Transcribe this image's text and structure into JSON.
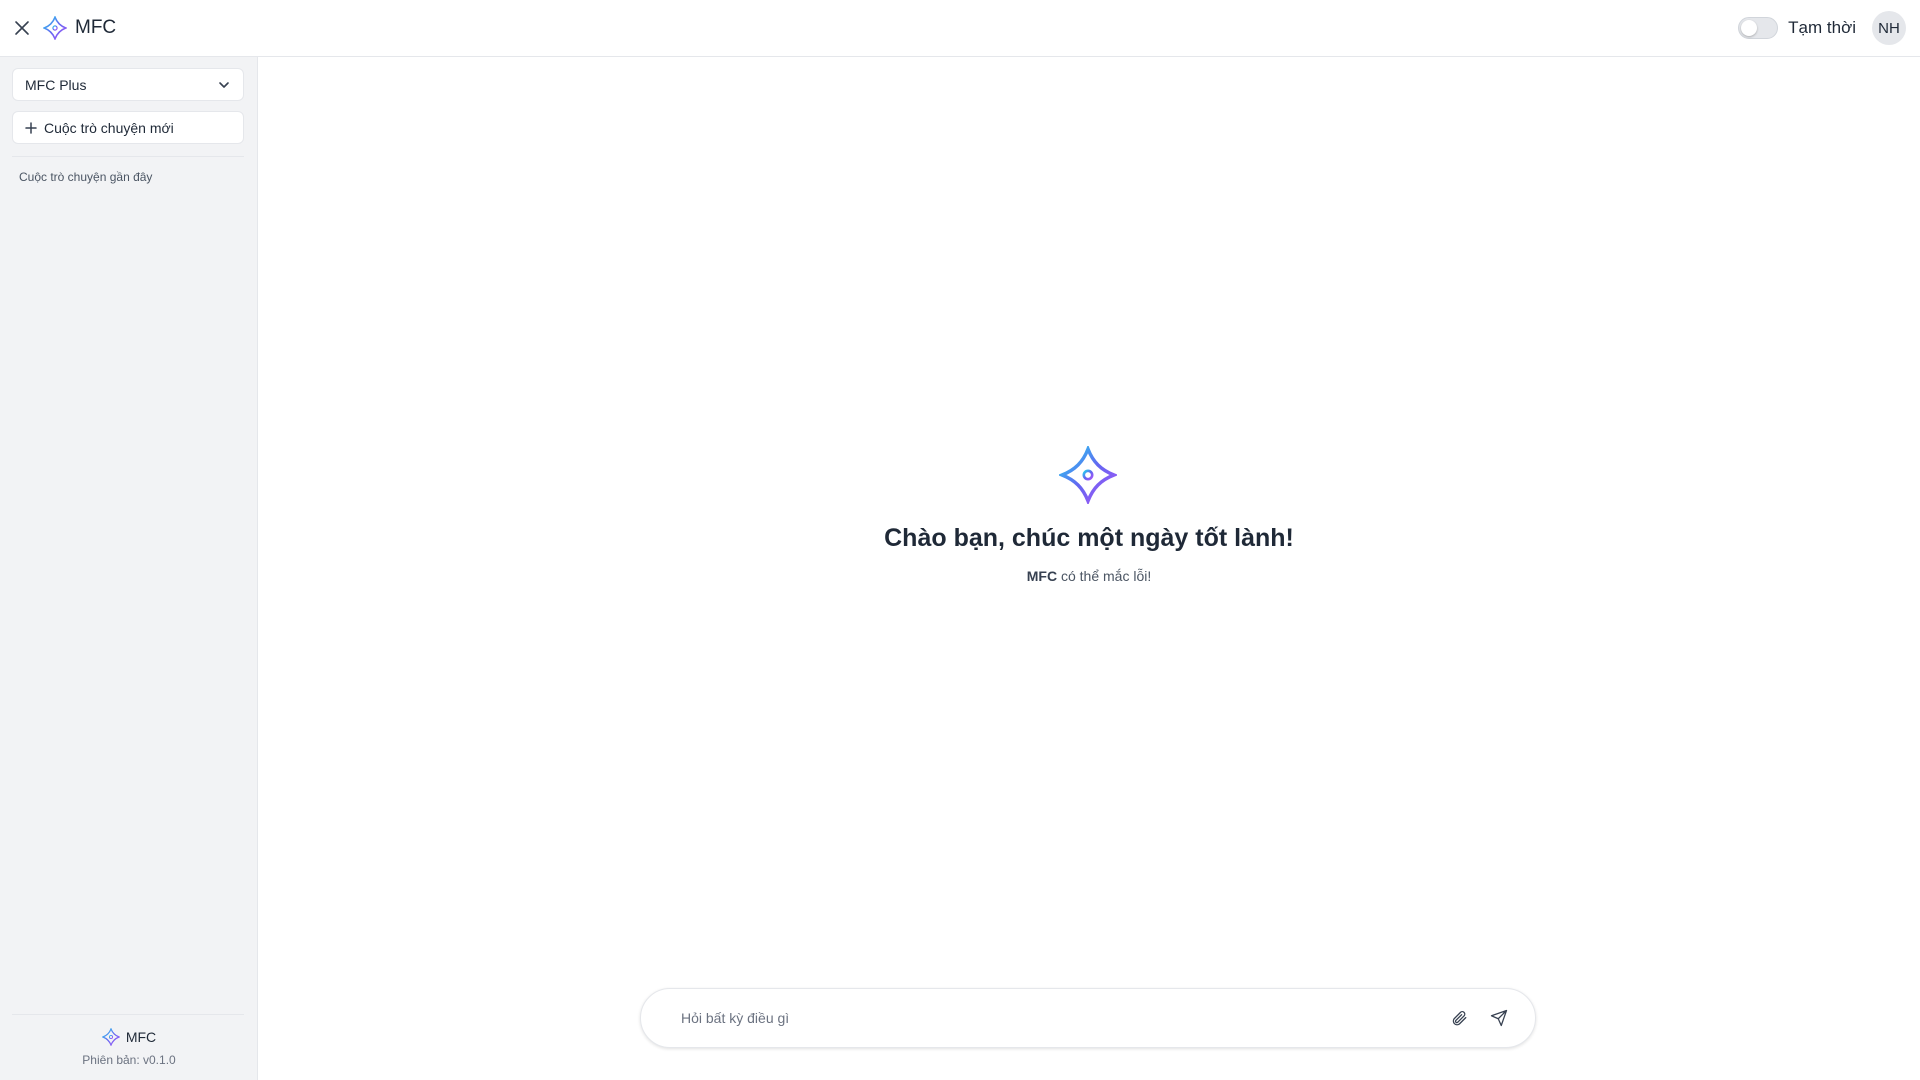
{
  "app": {
    "name": "MFC"
  },
  "header": {
    "close_icon": "close-icon",
    "temporary_label": "Tạm thời",
    "temporary_enabled": false,
    "avatar_initials": "NH"
  },
  "sidebar": {
    "model_select": {
      "value": "MFC Plus"
    },
    "new_chat_label": "Cuộc trò chuyện mới",
    "recent_label": "Cuộc trò chuyện gần đây",
    "footer": {
      "brand": "MFC",
      "version": "Phiên bản: v0.1.0"
    }
  },
  "main": {
    "greeting": "Chào bạn, chúc một ngày tốt lành!",
    "disclaimer_brand": "MFC",
    "disclaimer_text": " có thể mắc lỗi!"
  },
  "composer": {
    "placeholder": "Hỏi bất kỳ điều gì",
    "attach_icon": "paperclip-icon",
    "send_icon": "send-icon"
  },
  "colors": {
    "logo_gradient_start": "#6d28d9",
    "logo_gradient_end": "#22d3ee",
    "sidebar_bg": "#f2f3f5"
  }
}
